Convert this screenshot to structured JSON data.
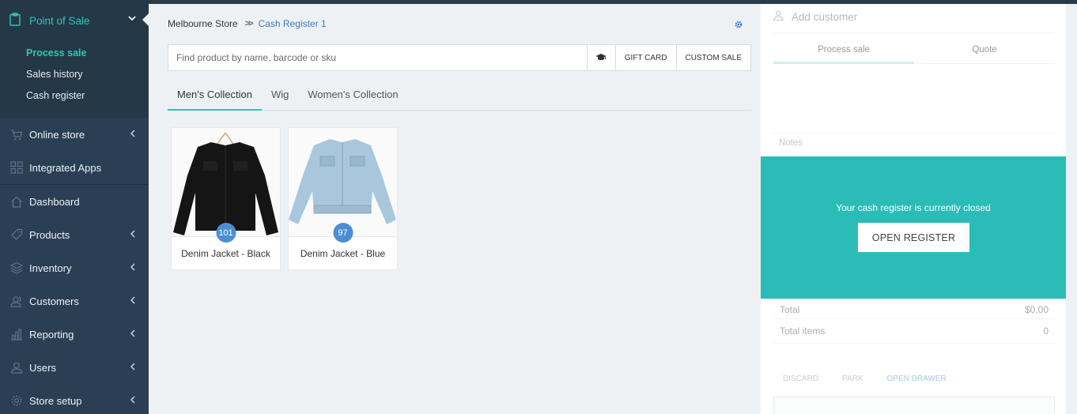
{
  "sidebar": {
    "section": {
      "label": "Point of Sale",
      "icon": "clipboard-icon"
    },
    "subitems": [
      {
        "label": "Process sale",
        "active": true
      },
      {
        "label": "Sales history",
        "active": false
      },
      {
        "label": "Cash register",
        "active": false
      }
    ],
    "items": [
      {
        "label": "Online store",
        "icon": "cart-icon",
        "has_chevron": true
      },
      {
        "label": "Integrated Apps",
        "icon": "grid-icon",
        "has_chevron": false
      },
      {
        "label": "Dashboard",
        "icon": "home-icon",
        "has_chevron": false
      },
      {
        "label": "Products",
        "icon": "tag-icon",
        "has_chevron": true
      },
      {
        "label": "Inventory",
        "icon": "layers-icon",
        "has_chevron": true
      },
      {
        "label": "Customers",
        "icon": "users-icon",
        "has_chevron": true
      },
      {
        "label": "Reporting",
        "icon": "bar-chart-icon",
        "has_chevron": true
      },
      {
        "label": "Users",
        "icon": "user-icon",
        "has_chevron": true
      },
      {
        "label": "Store setup",
        "icon": "gear-icon",
        "has_chevron": true
      }
    ]
  },
  "breadcrumb": {
    "store": "Melbourne Store",
    "register": "Cash Register 1"
  },
  "search": {
    "placeholder": "Find product by name, barcode or sku",
    "gift_card": "GIFT CARD",
    "custom_sale": "CUSTOM SALE"
  },
  "tabs": [
    {
      "label": "Men's Collection",
      "active": true
    },
    {
      "label": "Wig",
      "active": false
    },
    {
      "label": "Women's Collection",
      "active": false
    }
  ],
  "products": [
    {
      "name": "Denim Jacket - Black",
      "count": "101",
      "color": "#1a1a1a"
    },
    {
      "name": "Denim Jacket - Blue",
      "count": "97",
      "color": "#a9c7dc"
    }
  ],
  "cart": {
    "customer_placeholder": "Add customer",
    "tabs": [
      "Process sale",
      "Quote"
    ],
    "notes_label": "Notes",
    "closed_message": "Your cash register is currently closed",
    "open_button": "OPEN REGISTER",
    "total_label": "Total",
    "total_value": "$0.00",
    "items_label": "Total items",
    "items_value": "0",
    "actions": [
      "DISCARD",
      "PARK",
      "OPEN DRAWER"
    ]
  },
  "colors": {
    "accent": "#2fc5b9",
    "sidebar": "#2a3f54",
    "link": "#3a7bc8",
    "badge": "#4a8fd4",
    "register_closed": "#2bbcb8"
  }
}
